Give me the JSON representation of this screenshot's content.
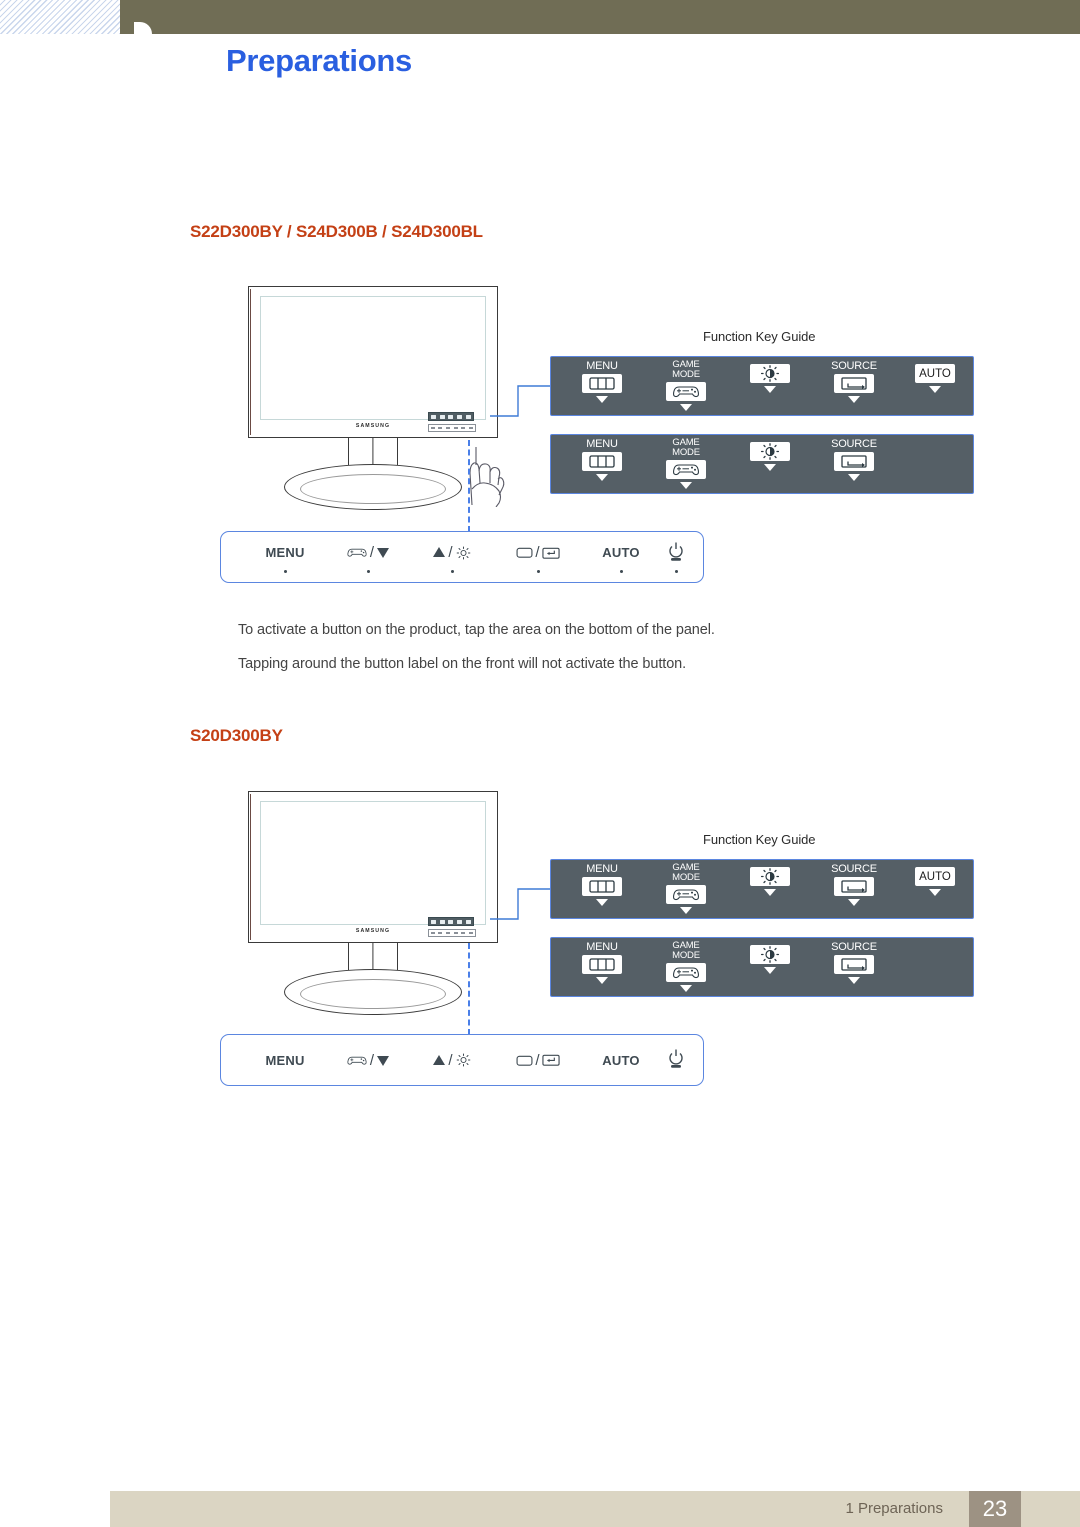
{
  "header": {
    "title": "Preparations",
    "bar_color": "#706d55",
    "title_color": "#2a5fe0"
  },
  "sections": [
    {
      "heading": "S22D300BY / S24D300B / S24D300BL",
      "heading_color": "#c44015",
      "monitor": {
        "logo": "SAMSUNG"
      },
      "fkg_title": "Function Key Guide",
      "panel_top": {
        "keys": [
          {
            "label": "MENU",
            "icon": "menu-bars-icon",
            "caret": true
          },
          {
            "label": "GAME\nMODE",
            "icon": "gamepad-icon",
            "caret": true
          },
          {
            "label": "",
            "icon": "brightness-icon",
            "caret": true
          },
          {
            "label": "SOURCE",
            "icon": "source-loop-icon",
            "caret": true
          },
          {
            "label": "",
            "icon": "auto-text-icon",
            "key_text": "AUTO",
            "caret": true
          }
        ]
      },
      "panel_bottom": {
        "keys": [
          {
            "label": "MENU",
            "icon": "menu-bars-icon",
            "caret": true
          },
          {
            "label": "GAME\nMODE",
            "icon": "gamepad-icon",
            "caret": true
          },
          {
            "label": "",
            "icon": "brightness-icon",
            "caret": true
          },
          {
            "label": "SOURCE",
            "icon": "source-loop-icon",
            "caret": true
          }
        ]
      },
      "button_bar": {
        "show_dots": true,
        "items": [
          {
            "name": "menu",
            "text": "MENU"
          },
          {
            "name": "gamemode-down",
            "icon_left": "gamepad-icon",
            "slash": "/",
            "icon_right": "triangle-down-icon"
          },
          {
            "name": "up-brightness",
            "icon_left": "triangle-up-icon",
            "slash": "/",
            "icon_right": "brightness-sun-icon"
          },
          {
            "name": "source-enter",
            "icon_left": "source-rect-icon",
            "slash": "/",
            "icon_right": "enter-arrow-icon"
          },
          {
            "name": "auto",
            "text": "AUTO"
          },
          {
            "name": "power",
            "icon_left": "power-icon"
          }
        ]
      },
      "notes": [
        "To activate a button on the product, tap the area on the bottom of the panel.",
        "Tapping around the button label on the front will not activate the button."
      ]
    },
    {
      "heading": "S20D300BY",
      "heading_color": "#c44015",
      "monitor": {
        "logo": "SAMSUNG"
      },
      "fkg_title": "Function Key Guide",
      "panel_top": {
        "keys": [
          {
            "label": "MENU",
            "icon": "menu-bars-icon",
            "caret": true
          },
          {
            "label": "GAME\nMODE",
            "icon": "gamepad-icon",
            "caret": true
          },
          {
            "label": "",
            "icon": "brightness-icon",
            "caret": true
          },
          {
            "label": "SOURCE",
            "icon": "source-loop-icon",
            "caret": true
          },
          {
            "label": "",
            "icon": "auto-text-icon",
            "key_text": "AUTO",
            "caret": true
          }
        ]
      },
      "panel_bottom": {
        "keys": [
          {
            "label": "MENU",
            "icon": "menu-bars-icon",
            "caret": true
          },
          {
            "label": "GAME\nMODE",
            "icon": "gamepad-icon",
            "caret": true
          },
          {
            "label": "",
            "icon": "brightness-icon",
            "caret": true
          },
          {
            "label": "SOURCE",
            "icon": "source-loop-icon",
            "caret": true
          }
        ]
      },
      "button_bar": {
        "show_dots": false,
        "items": [
          {
            "name": "menu",
            "text": "MENU"
          },
          {
            "name": "gamemode-down",
            "icon_left": "gamepad-icon",
            "slash": "/",
            "icon_right": "triangle-down-icon"
          },
          {
            "name": "up-brightness",
            "icon_left": "triangle-up-icon",
            "slash": "/",
            "icon_right": "brightness-sun-icon"
          },
          {
            "name": "source-enter",
            "icon_left": "source-rect-icon",
            "slash": "/",
            "icon_right": "enter-arrow-icon"
          },
          {
            "name": "auto",
            "text": "AUTO"
          },
          {
            "name": "power",
            "icon_left": "power-icon"
          }
        ]
      },
      "notes": []
    }
  ],
  "footer": {
    "chapter": "1 Preparations",
    "page_number": "23",
    "bar_color": "#dbd5c3",
    "page_box_color": "#9d9283"
  }
}
